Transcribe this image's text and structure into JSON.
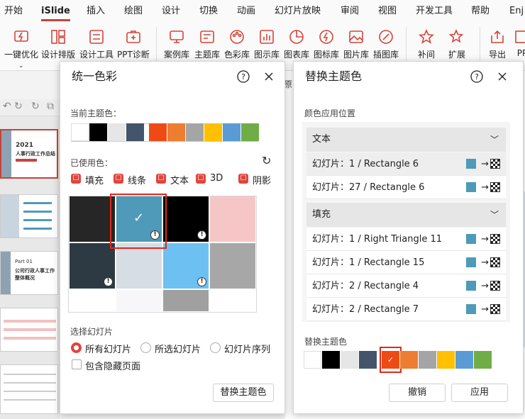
{
  "ribbon": {
    "tabs": [
      "开始",
      "iSlide",
      "插入",
      "绘图",
      "设计",
      "切换",
      "动画",
      "幻灯片放映",
      "审阅",
      "视图",
      "开发工具",
      "帮助",
      "Enj"
    ],
    "buttons": [
      "一键优化",
      "设计排版",
      "设计工具",
      "PPT诊断",
      "案例库",
      "主题库",
      "色彩库",
      "图示库",
      "图表库",
      "图标库",
      "图片库",
      "插图库",
      "补间",
      "扩展",
      "导出",
      "PP"
    ]
  },
  "dialog1": {
    "title": "统一色彩",
    "current_theme_label": "当前主题色：",
    "theme_colors": [
      "#ffffff",
      "#000000",
      "#e7e6e6",
      "#44546a",
      "#f04a14",
      "#ed7d31",
      "#a5a5a5",
      "#ffc000",
      "#5b9bd5",
      "#70ad47"
    ],
    "used_colors_label": "已使用色：",
    "filters": [
      "填充",
      "线条",
      "文本",
      "3D",
      "阴影"
    ],
    "grid_colors": [
      "#262626",
      "#4e9ab8",
      "#000000",
      "#f6c6c6",
      "#2d3a44",
      "#d7dde4",
      "#6dc1f2",
      "#a7a7a7",
      "#ffffff",
      "#f7f6f8",
      "#a0a0a0"
    ],
    "select_slides_label": "选择幻灯片",
    "radio_options": [
      "所有幻灯片",
      "所选幻灯片",
      "幻灯片序列"
    ],
    "include_hidden": "包含隐藏页面",
    "replace_button": "替换主题色"
  },
  "dialog2": {
    "title": "替换主题色",
    "color_location_label": "颜色应用位置",
    "groups": [
      {
        "name": "文本",
        "rows": [
          "幻灯片：1 / Rectangle 6",
          "幻灯片：27 / Rectangle 6"
        ]
      },
      {
        "name": "填充",
        "rows": [
          "幻灯片：1 / Right Triangle 11",
          "幻灯片：1 / Rectangle 15",
          "幻灯片：2 / Rectangle 4",
          "幻灯片：2 / Rectangle 7"
        ]
      }
    ],
    "replace_theme_label": "替换主题色",
    "theme_colors": [
      "#ffffff",
      "#000000",
      "#e7e6e6",
      "#44546a",
      "#f04a14",
      "#ed7d31",
      "#a5a5a5",
      "#ffc000",
      "#5b9bd5",
      "#70ad47"
    ],
    "cancel": "撤销",
    "apply": "应用"
  },
  "thumbs": {
    "t1_year": "2021",
    "t1_title": "人事行政工作总结",
    "t3_part": "Part 01",
    "t3_title": "公司行政人事工作整体概况"
  },
  "editor": {
    "fragment": "原"
  }
}
